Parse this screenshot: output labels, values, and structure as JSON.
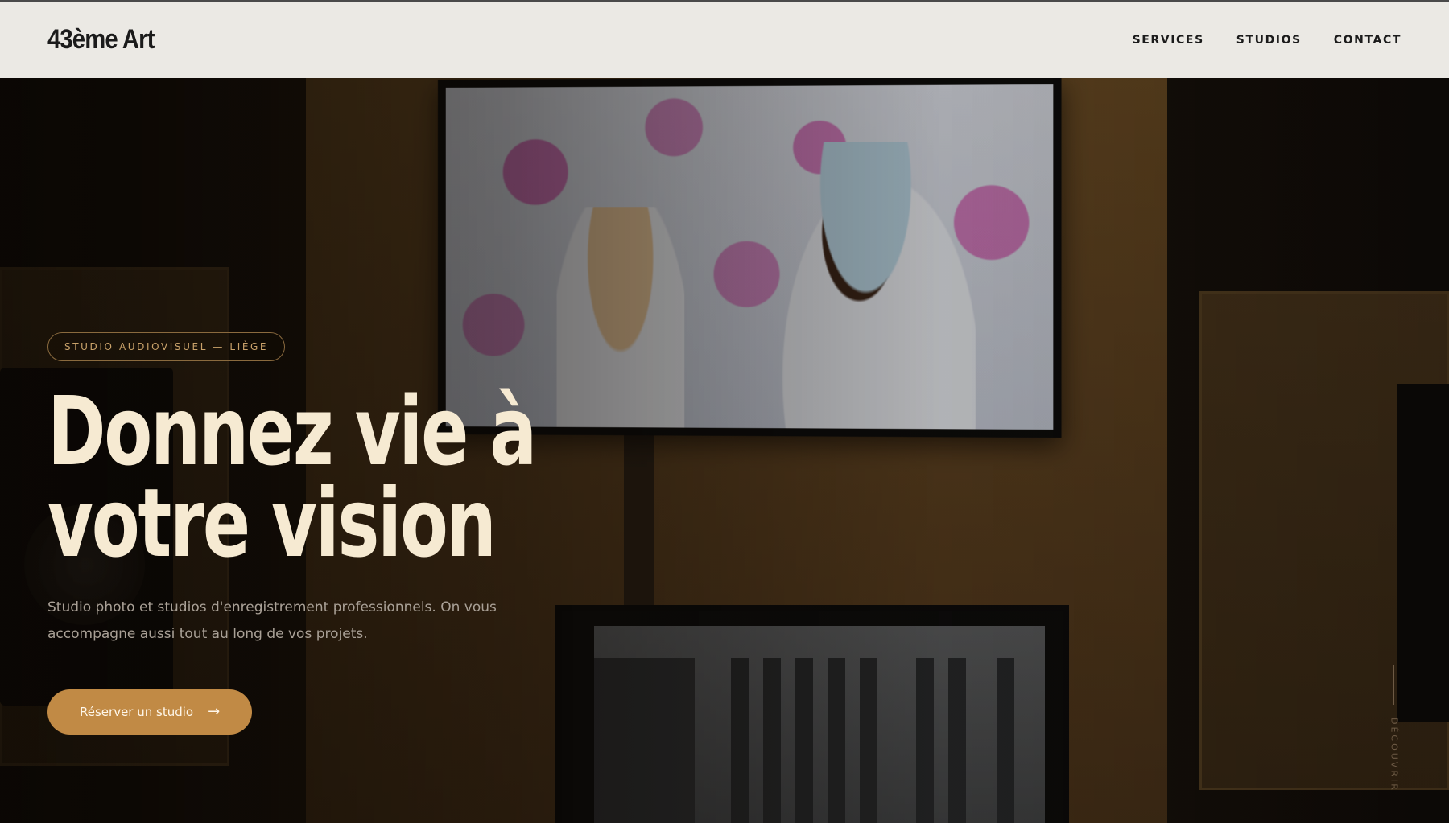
{
  "header": {
    "logo": "43ème Art",
    "nav": [
      "SERVICES",
      "STUDIOS",
      "CONTACT"
    ]
  },
  "hero": {
    "badge": "STUDIO AUDIOVISUEL — LIÈGE",
    "headline_line1": "Donnez vie à",
    "headline_line2": "votre vision",
    "subtitle_line1": "Studio photo et studios d'enregistrement professionnels. On vous",
    "subtitle_line2": "accompagne aussi tout au long de vos projets.",
    "cta_label": "Réserver un studio",
    "cta_icon": "arrow-right-icon",
    "scroll_label": "DÉCOUVRIR"
  },
  "colors": {
    "accent": "#c18a45",
    "headline": "#f6ead2",
    "header_bg": "#ebe9e4"
  }
}
